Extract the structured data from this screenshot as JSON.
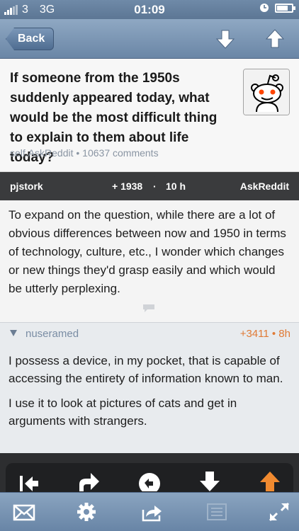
{
  "status_bar": {
    "carrier": "3",
    "network": "3G",
    "time": "01:09"
  },
  "nav": {
    "back_label": "Back",
    "icons": [
      "down-arrow-icon",
      "up-arrow-icon"
    ]
  },
  "post": {
    "title": "If someone from the 1950s suddenly appeared today, what would be the most difficult thing to explain to them about life today?",
    "domain": "self.AskReddit",
    "separator": " • ",
    "comments": "10637 comments",
    "thumbnail_icon": "reddit-alien-icon"
  },
  "author_bar": {
    "author": "pjstork",
    "score": "+ 1938",
    "dot": "·",
    "age": "10 h",
    "subreddit": "AskReddit"
  },
  "selftext": "To expand on the question, while there are a lot of obvious differences between now and 1950 in terms of technology, culture, etc., I wonder which changes or new things they'd grasp easily and which would be utterly perplexing.",
  "comment": {
    "author": "nuseramed",
    "score": "+3411 • 8h",
    "paragraphs": [
      "I possess a device, in my pocket, that is capable of accessing the entirety of information known to man.",
      "I use it to look at pictures of cats and get in arguments with strangers."
    ]
  },
  "action_bar": {
    "icons": [
      "collapse-to-parent-icon",
      "reply-icon",
      "undo-icon",
      "downvote-icon",
      "upvote-icon"
    ],
    "colors": {
      "upvote": "#f08a30",
      "default": "#ffffff"
    }
  },
  "toolbar": {
    "icons": [
      "mail-icon",
      "gear-icon",
      "share-icon",
      "list-icon",
      "fullscreen-icon"
    ]
  }
}
